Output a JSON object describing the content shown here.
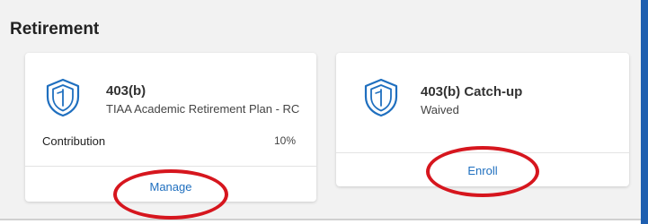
{
  "section": {
    "title": "Retirement"
  },
  "cards": [
    {
      "icon": "shield-icon",
      "name": "403(b)",
      "subtitle": "TIAA Academic Retirement Plan - RC",
      "contribution_label": "Contribution",
      "contribution_value": "10%",
      "action_label": "Manage"
    },
    {
      "icon": "shield-icon",
      "name": "403(b) Catch-up",
      "subtitle": "Waived",
      "action_label": "Enroll"
    }
  ],
  "colors": {
    "panel_bg": "#f2f2f2",
    "link": "#1f6fbf",
    "icon": "#1f6fbf",
    "annotation": "#d6161e",
    "accent": "#1e5fb0"
  }
}
